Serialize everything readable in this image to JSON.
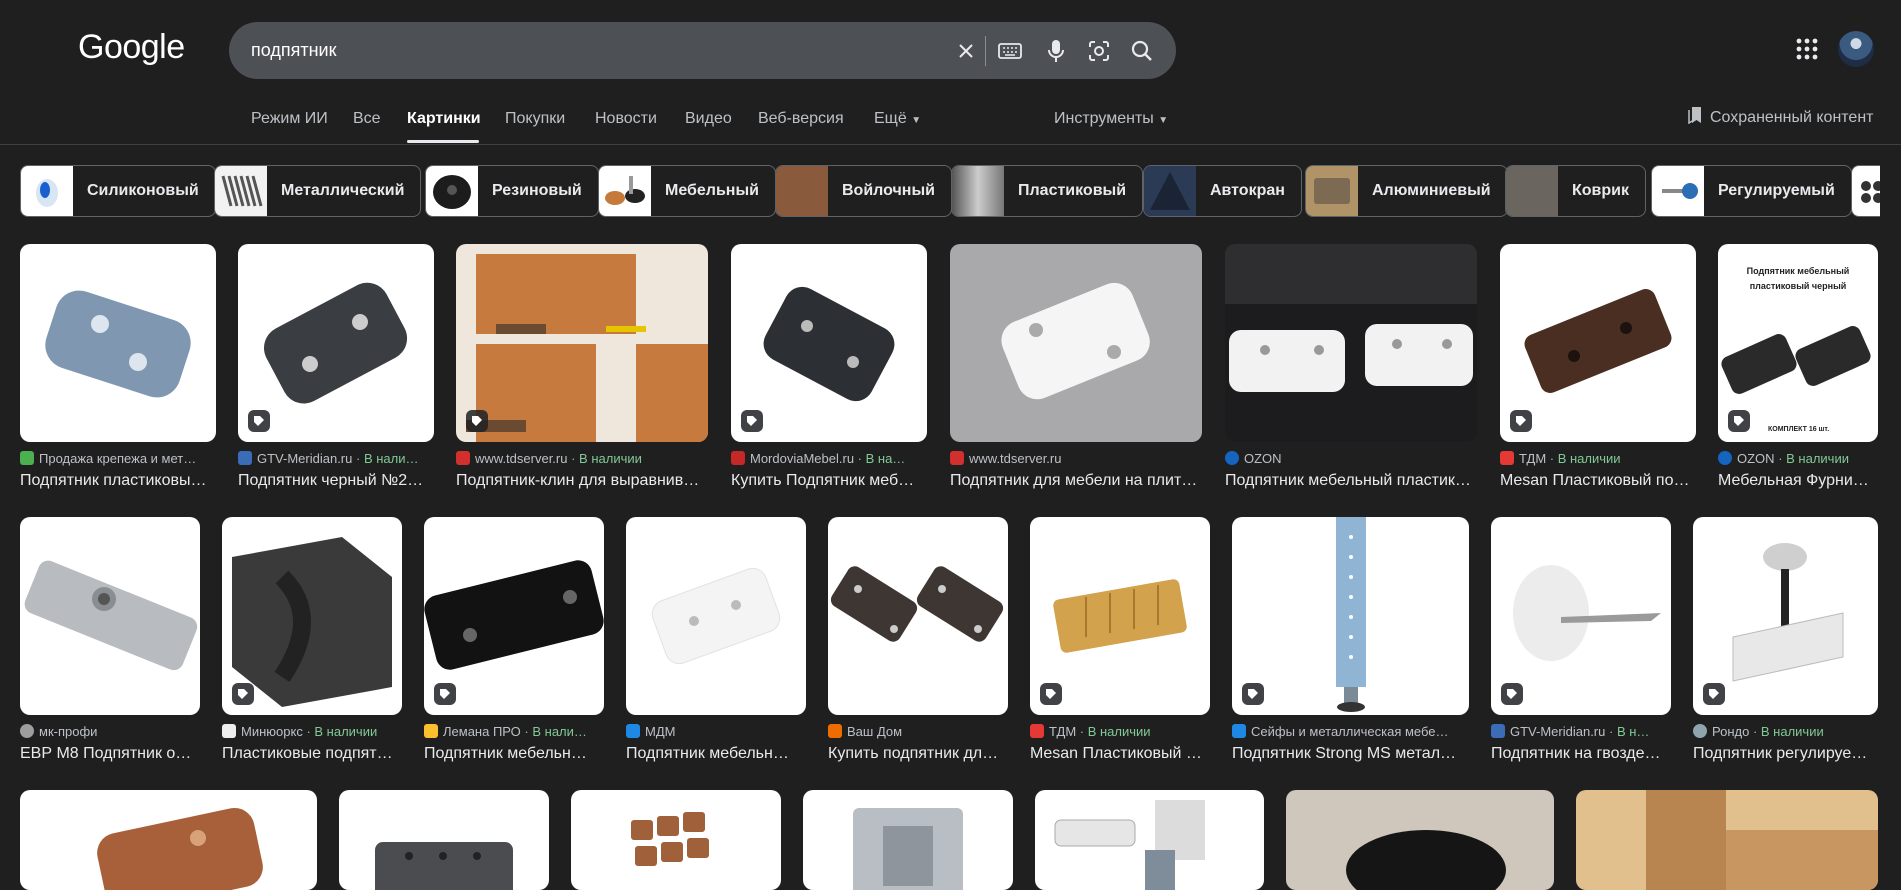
{
  "header": {
    "logo": "Google",
    "query": "подпятник"
  },
  "tabs": [
    {
      "label": "Режим ИИ"
    },
    {
      "label": "Все"
    },
    {
      "label": "Картинки"
    },
    {
      "label": "Покупки"
    },
    {
      "label": "Новости"
    },
    {
      "label": "Видео"
    },
    {
      "label": "Веб-версия"
    },
    {
      "label": "Ещё"
    }
  ],
  "tools_label": "Инструменты",
  "saved_label": "Сохраненный контент",
  "chips": [
    {
      "label": "Силиконовый"
    },
    {
      "label": "Металлический"
    },
    {
      "label": "Резиновый"
    },
    {
      "label": "Мебельный"
    },
    {
      "label": "Войлочный"
    },
    {
      "label": "Пластиковый"
    },
    {
      "label": "Автокран"
    },
    {
      "label": "Алюминиевый"
    },
    {
      "label": "Коврик"
    },
    {
      "label": "Регулируемый"
    }
  ],
  "row1": [
    {
      "source": "Продажа крепежа и мет…",
      "avail": "",
      "title": "Подпятник пластиковы…"
    },
    {
      "source": "GTV-Meridian.ru",
      "avail": "· В нали…",
      "title": "Подпятник черный №2…"
    },
    {
      "source": "www.tdserver.ru",
      "avail": "· В наличии",
      "title": "Подпятник-клин для выравнив…"
    },
    {
      "source": "MordoviaMebel.ru",
      "avail": "· В на…",
      "title": "Купить Подпятник меб…"
    },
    {
      "source": "www.tdserver.ru",
      "avail": "",
      "title": "Подпятник для мебели на плит…"
    },
    {
      "source": "OZON",
      "avail": "",
      "title": "Подпятник мебельный пластик…"
    },
    {
      "source": "ТДМ",
      "avail": "· В наличии",
      "title": "Mesan Пластиковый по…"
    },
    {
      "source": "OZON",
      "avail": "· В наличии",
      "title": "Мебельная Фурни…",
      "img_text": "Подпятник мебельный пластиковый черный",
      "img_sub": "КОМПЛЕКТ 16 шт."
    }
  ],
  "row2": [
    {
      "source": "мк-профи",
      "avail": "",
      "title": "ЕВР М8 Подпятник о…"
    },
    {
      "source": "Минюоркс",
      "avail": "· В наличии",
      "title": "Пластиковые подпят…"
    },
    {
      "source": "Лемана ПРО",
      "avail": "· В нали…",
      "title": "Подпятник мебельн…"
    },
    {
      "source": "МДМ",
      "avail": "",
      "title": "Подпятник мебельн…"
    },
    {
      "source": "Ваш Дом",
      "avail": "",
      "title": "Купить подпятник дл…"
    },
    {
      "source": "ТДМ",
      "avail": "· В наличии",
      "title": "Mesan Пластиковый …"
    },
    {
      "source": "Сейфы и металлическая мебе…",
      "avail": "",
      "title": "Подпятник Strong MS метал…"
    },
    {
      "source": "GTV-Meridian.ru",
      "avail": "· В н…",
      "title": "Подпятник на гвозде…"
    },
    {
      "source": "Рондо",
      "avail": "· В наличии",
      "title": "Подпятник регулируе…"
    }
  ],
  "colors": {
    "background": "#1f1f1f",
    "search_bg": "#4d5156",
    "available": "#81c995"
  }
}
